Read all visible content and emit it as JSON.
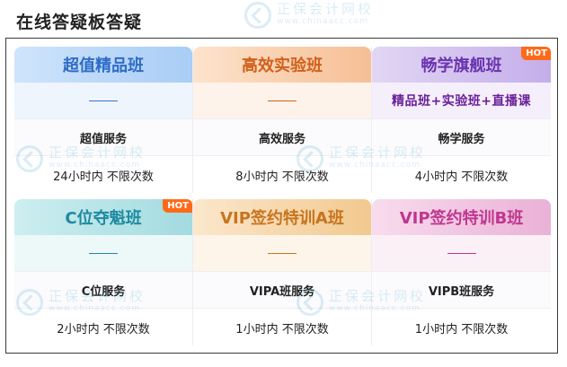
{
  "page": {
    "title": "在线答疑板答疑"
  },
  "watermark": {
    "brand": "正保会计网校",
    "url": "www.chinaacc.com"
  },
  "badge": {
    "hot": "HOT"
  },
  "cards": [
    {
      "name": "超值精品班",
      "subtitle": "",
      "service": "超值服务",
      "count": "24小时内 不限次数",
      "hot": false
    },
    {
      "name": "高效实验班",
      "subtitle": "",
      "service": "高效服务",
      "count": "8小时内 不限次数",
      "hot": false
    },
    {
      "name": "畅学旗舰班",
      "subtitle": "精品班+实验班+直播课",
      "service": "畅学服务",
      "count": "4小时内 不限次数",
      "hot": true
    },
    {
      "name": "C位夺魁班",
      "subtitle": "",
      "service": "C位服务",
      "count": "2小时内 不限次数",
      "hot": true
    },
    {
      "name": "VIP签约特训A班",
      "subtitle": "",
      "service": "VIPA班服务",
      "count": "1小时内 不限次数",
      "hot": false
    },
    {
      "name": "VIP签约特训B班",
      "subtitle": "",
      "service": "VIPB班服务",
      "count": "1小时内 不限次数",
      "hot": false
    }
  ],
  "colors": {
    "hot_badge": "#ff6a1a",
    "frame_border": "#3a3a3a"
  }
}
